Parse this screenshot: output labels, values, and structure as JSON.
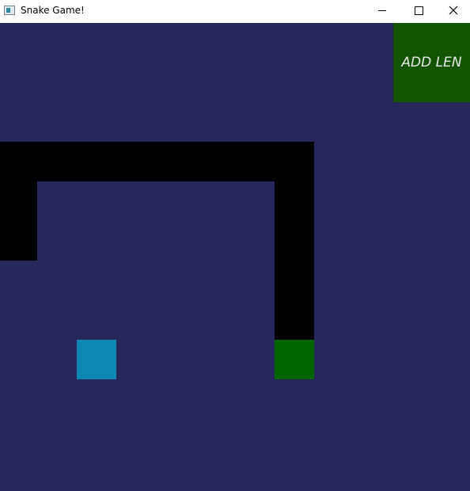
{
  "window": {
    "title": "Snake Game!",
    "app_icon": "app-window-icon",
    "controls": {
      "minimize_icon": "minimize-icon",
      "maximize_icon": "maximize-icon",
      "close_icon": "close-icon"
    }
  },
  "game": {
    "add_len_label": "ADD LEN",
    "colors": {
      "background": "#27275c",
      "snake_body": "#000000",
      "snake_head": "#006400",
      "food": "#0d87b4",
      "add_len_button": "#125400"
    }
  }
}
